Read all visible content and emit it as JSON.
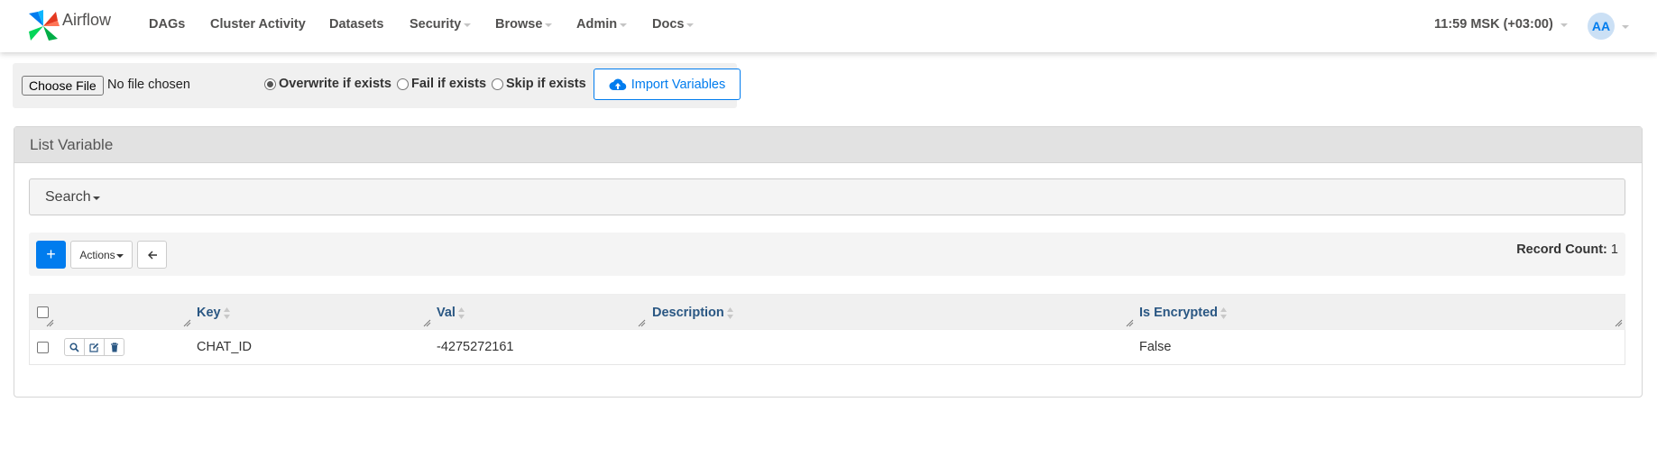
{
  "brand": {
    "name": "Airflow",
    "logo_icon": "airflow-pinwheel-logo"
  },
  "nav": {
    "items": [
      {
        "label": "DAGs",
        "dropdown": false
      },
      {
        "label": "Cluster Activity",
        "dropdown": false
      },
      {
        "label": "Datasets",
        "dropdown": false
      },
      {
        "label": "Security",
        "dropdown": true
      },
      {
        "label": "Browse",
        "dropdown": true
      },
      {
        "label": "Admin",
        "dropdown": true
      },
      {
        "label": "Docs",
        "dropdown": true
      }
    ],
    "time": "11:59 MSK (+03:00)",
    "user_initials": "AA"
  },
  "import_form": {
    "file_button": "Choose File",
    "file_status": "No file chosen",
    "options": [
      {
        "label": "Overwrite if exists",
        "checked": true
      },
      {
        "label": "Fail if exists",
        "checked": false
      },
      {
        "label": "Skip if exists",
        "checked": false
      }
    ],
    "import_button": "Import Variables"
  },
  "panel": {
    "title": "List Variable",
    "search_label": "Search",
    "toolbar": {
      "add_label": "+",
      "actions_label": "Actions",
      "record_count_label": "Record Count:",
      "record_count": "1"
    },
    "table": {
      "columns": [
        "Key",
        "Val",
        "Description",
        "Is Encrypted"
      ],
      "rows": [
        {
          "key": "CHAT_ID",
          "val": "-4275272161",
          "description": "",
          "is_encrypted": "False"
        }
      ]
    }
  },
  "colors": {
    "accent": "#017cee",
    "nav_text": "#51504f",
    "header_link": "#2a5783",
    "panel_heading_bg": "#e2e2e2"
  }
}
